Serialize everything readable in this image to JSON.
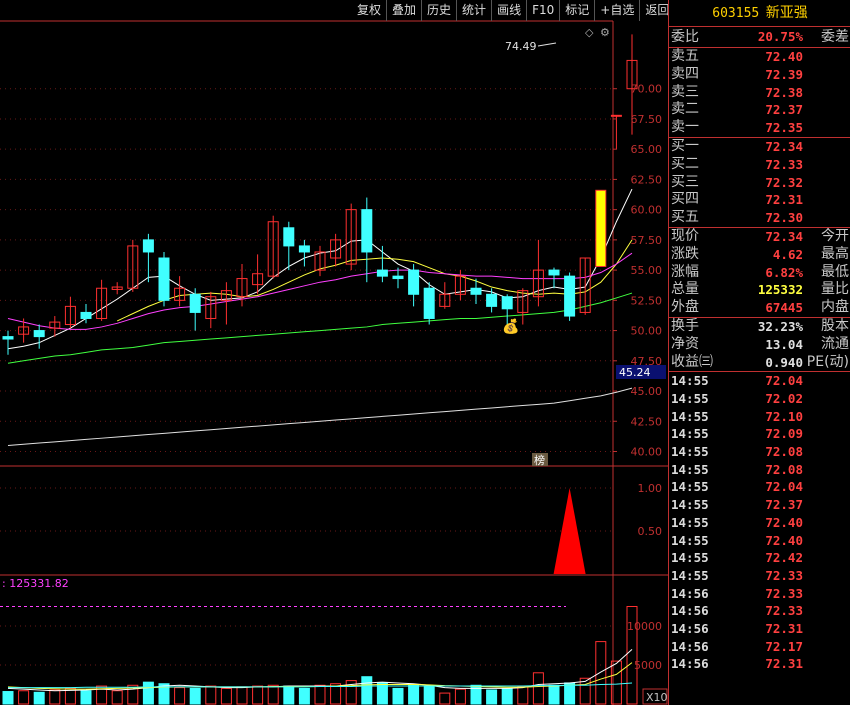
{
  "toolbar": [
    "复权",
    "叠加",
    "历史",
    "统计",
    "画线",
    "F10",
    "标记",
    "+自选",
    "返回"
  ],
  "stock": {
    "code": "603155",
    "name": "新亚强"
  },
  "weibi": {
    "label": "委比",
    "value": "20.75%",
    "label2": "委差"
  },
  "sell": [
    {
      "label": "卖五",
      "price": "72.40"
    },
    {
      "label": "卖四",
      "price": "72.39"
    },
    {
      "label": "卖三",
      "price": "72.38"
    },
    {
      "label": "卖二",
      "price": "72.37"
    },
    {
      "label": "卖一",
      "price": "72.35"
    }
  ],
  "buy": [
    {
      "label": "买一",
      "price": "72.34"
    },
    {
      "label": "买二",
      "price": "72.33"
    },
    {
      "label": "买三",
      "price": "72.32"
    },
    {
      "label": "买四",
      "price": "72.31"
    },
    {
      "label": "买五",
      "price": "72.30"
    }
  ],
  "quote": [
    {
      "label": "现价",
      "value": "72.34",
      "label2": "今开",
      "color": "red"
    },
    {
      "label": "涨跌",
      "value": "4.62",
      "label2": "最高",
      "color": "red"
    },
    {
      "label": "涨幅",
      "value": "6.82%",
      "label2": "最低",
      "color": "red"
    },
    {
      "label": "总量",
      "value": "125332",
      "label2": "量比",
      "color": "yellow"
    },
    {
      "label": "外盘",
      "value": "67445",
      "label2": "内盘",
      "color": "red"
    }
  ],
  "extra": [
    {
      "label": "换手",
      "value": "32.23%",
      "label2": "股本"
    },
    {
      "label": "净资",
      "value": "13.04",
      "label2": "流通"
    },
    {
      "label": "收益㈢",
      "value": "0.940",
      "label2": "PE(动)"
    }
  ],
  "ticks": [
    {
      "time": "14:55",
      "price": "72.04"
    },
    {
      "time": "14:55",
      "price": "72.02"
    },
    {
      "time": "14:55",
      "price": "72.10"
    },
    {
      "time": "14:55",
      "price": "72.09"
    },
    {
      "time": "14:55",
      "price": "72.08"
    },
    {
      "time": "14:55",
      "price": "72.08"
    },
    {
      "time": "14:55",
      "price": "72.04"
    },
    {
      "time": "14:55",
      "price": "72.37"
    },
    {
      "time": "14:55",
      "price": "72.40"
    },
    {
      "time": "14:55",
      "price": "72.40"
    },
    {
      "time": "14:55",
      "price": "72.42"
    },
    {
      "time": "14:55",
      "price": "72.33"
    },
    {
      "time": "14:56",
      "price": "72.33"
    },
    {
      "time": "14:56",
      "price": "72.33"
    },
    {
      "time": "14:56",
      "price": "72.31"
    },
    {
      "time": "14:56",
      "price": "72.17"
    },
    {
      "time": "14:56",
      "price": "72.31"
    }
  ],
  "chart_data": {
    "type": "candlestick",
    "price_axis": {
      "ticks": [
        "40.00",
        "42.50",
        "45.00",
        "47.50",
        "50.00",
        "52.50",
        "55.00",
        "57.50",
        "60.00",
        "62.50",
        "65.00",
        "67.50",
        "70.00"
      ],
      "ylim": [
        38.8,
        75.6
      ]
    },
    "high_label": "74.49",
    "current_marker": "45.24",
    "bang_label": "榜",
    "indicator_axis": {
      "ticks": [
        "1.00",
        "0.50"
      ]
    },
    "volume_axis": {
      "ticks": [
        "10000",
        "5000"
      ],
      "multiplier": "X10"
    },
    "volume_header": ": 125331.82",
    "candles": [
      {
        "o": 49.5,
        "c": 49.3,
        "h": 50.0,
        "l": 48.0
      },
      {
        "o": 49.7,
        "c": 50.3,
        "h": 51.0,
        "l": 49.0
      },
      {
        "o": 50.0,
        "c": 49.5,
        "h": 50.5,
        "l": 48.5
      },
      {
        "o": 50.2,
        "c": 50.7,
        "h": 51.2,
        "l": 49.5
      },
      {
        "o": 50.5,
        "c": 52.0,
        "h": 52.8,
        "l": 50.2
      },
      {
        "o": 51.5,
        "c": 51.0,
        "h": 52.2,
        "l": 50.6
      },
      {
        "o": 51.0,
        "c": 53.5,
        "h": 54.2,
        "l": 50.8
      },
      {
        "o": 53.4,
        "c": 53.6,
        "h": 54.0,
        "l": 53.0
      },
      {
        "o": 53.5,
        "c": 57.0,
        "h": 57.5,
        "l": 53.2
      },
      {
        "o": 57.5,
        "c": 56.5,
        "h": 58.0,
        "l": 54.0
      },
      {
        "o": 56.0,
        "c": 52.5,
        "h": 56.5,
        "l": 52.0
      },
      {
        "o": 52.5,
        "c": 53.5,
        "h": 54.5,
        "l": 52.0
      },
      {
        "o": 53.0,
        "c": 51.5,
        "h": 53.5,
        "l": 50.0
      },
      {
        "o": 51.0,
        "c": 52.8,
        "h": 53.2,
        "l": 50.2
      },
      {
        "o": 52.5,
        "c": 53.3,
        "h": 54.0,
        "l": 50.5
      },
      {
        "o": 52.8,
        "c": 54.3,
        "h": 55.5,
        "l": 52.0
      },
      {
        "o": 53.8,
        "c": 54.7,
        "h": 56.3,
        "l": 53.0
      },
      {
        "o": 54.5,
        "c": 59.0,
        "h": 59.5,
        "l": 54.3
      },
      {
        "o": 58.5,
        "c": 57.0,
        "h": 59.0,
        "l": 55.0
      },
      {
        "o": 57.0,
        "c": 56.5,
        "h": 57.5,
        "l": 55.3
      },
      {
        "o": 55.0,
        "c": 56.5,
        "h": 57.0,
        "l": 54.5
      },
      {
        "o": 56.0,
        "c": 57.5,
        "h": 58.0,
        "l": 55.3
      },
      {
        "o": 55.5,
        "c": 60.0,
        "h": 60.5,
        "l": 55.0
      },
      {
        "o": 60.0,
        "c": 56.5,
        "h": 61.0,
        "l": 54.0
      },
      {
        "o": 55.0,
        "c": 54.5,
        "h": 57.0,
        "l": 54.0
      },
      {
        "o": 54.5,
        "c": 54.3,
        "h": 55.2,
        "l": 53.5
      },
      {
        "o": 55.0,
        "c": 53.0,
        "h": 55.5,
        "l": 52.0
      },
      {
        "o": 53.5,
        "c": 51.0,
        "h": 54.0,
        "l": 50.5
      },
      {
        "o": 52.0,
        "c": 53.0,
        "h": 54.0,
        "l": 51.8
      },
      {
        "o": 53.0,
        "c": 54.5,
        "h": 55.0,
        "l": 52.5
      },
      {
        "o": 53.5,
        "c": 53.0,
        "h": 54.3,
        "l": 52.2
      },
      {
        "o": 53.0,
        "c": 52.0,
        "h": 53.5,
        "l": 51.5
      },
      {
        "o": 52.8,
        "c": 51.8,
        "h": 53.0,
        "l": 50.0
      },
      {
        "o": 51.5,
        "c": 53.3,
        "h": 53.5,
        "l": 50.5
      },
      {
        "o": 52.8,
        "c": 55.0,
        "h": 57.5,
        "l": 52.0
      },
      {
        "o": 55.0,
        "c": 54.6,
        "h": 55.2,
        "l": 53.5
      },
      {
        "o": 54.5,
        "c": 51.2,
        "h": 54.8,
        "l": 50.8
      },
      {
        "o": 51.5,
        "c": 56.0,
        "h": 56.0,
        "l": 51.3
      },
      {
        "o": 55.3,
        "c": 61.6,
        "h": 61.6,
        "l": 55.3
      },
      {
        "o": 67.8,
        "c": 67.8,
        "h": 67.8,
        "l": 65.0
      },
      {
        "o": 70.0,
        "c": 72.34,
        "h": 74.49,
        "l": 66.2
      }
    ],
    "ma_series": [
      {
        "color": "#ffffff",
        "values": [
          48.5,
          48.7,
          49.0,
          49.6,
          50.2,
          51.0,
          51.8,
          52.6,
          53.5,
          54.4,
          54.5,
          53.7,
          53.0,
          52.5,
          52.6,
          52.7,
          53.2,
          54.4,
          55.3,
          56.0,
          56.4,
          56.6,
          57.4,
          57.5,
          56.5,
          55.5,
          54.9,
          53.8,
          53.0,
          53.2,
          53.4,
          53.2,
          52.7,
          52.8,
          53.3,
          53.6,
          53.4,
          53.6,
          56.0,
          59.0,
          61.7
        ]
      },
      {
        "color": "#ffff40",
        "values": [
          null,
          null,
          null,
          null,
          null,
          null,
          null,
          50.8,
          51.4,
          52.0,
          52.5,
          52.9,
          53.0,
          53.1,
          53.0,
          52.8,
          52.9,
          53.4,
          54.0,
          54.6,
          55.1,
          55.4,
          55.8,
          55.9,
          56.0,
          55.9,
          55.7,
          55.2,
          54.7,
          54.5,
          54.1,
          53.6,
          53.3,
          53.1,
          53.0,
          53.1,
          53.0,
          53.2,
          54.0,
          55.5,
          57.5
        ]
      },
      {
        "color": "#ff40ff",
        "values": [
          51.0,
          50.7,
          50.4,
          50.2,
          50.1,
          50.1,
          50.3,
          50.6,
          51.0,
          51.4,
          51.7,
          51.9,
          52.0,
          52.2,
          52.4,
          52.6,
          52.8,
          53.1,
          53.4,
          53.7,
          54.0,
          54.2,
          54.5,
          54.7,
          54.9,
          55.0,
          55.0,
          54.8,
          54.7,
          54.6,
          54.5,
          54.5,
          54.4,
          54.3,
          54.3,
          54.3,
          54.3,
          54.4,
          54.8,
          55.5,
          56.4
        ]
      },
      {
        "color": "#40ff40",
        "values": [
          47.3,
          47.5,
          47.7,
          47.9,
          48.0,
          48.2,
          48.4,
          48.5,
          48.6,
          48.8,
          49.0,
          49.1,
          49.2,
          49.3,
          49.4,
          49.5,
          49.6,
          49.7,
          49.8,
          49.9,
          50.0,
          50.1,
          50.2,
          50.3,
          50.5,
          50.6,
          50.7,
          50.8,
          50.9,
          51.0,
          51.0,
          51.1,
          51.2,
          51.3,
          51.4,
          51.5,
          51.7,
          52.0,
          52.3,
          52.7,
          53.1
        ]
      },
      {
        "color": "#e0e0e0",
        "values": [
          40.5,
          40.6,
          40.7,
          40.8,
          40.9,
          41.0,
          41.1,
          41.2,
          41.3,
          41.4,
          41.5,
          41.6,
          41.7,
          41.8,
          41.9,
          42.0,
          42.1,
          42.2,
          42.3,
          42.4,
          42.5,
          42.6,
          42.7,
          42.8,
          42.9,
          43.0,
          43.1,
          43.2,
          43.3,
          43.4,
          43.5,
          43.6,
          43.7,
          43.8,
          43.9,
          44.0,
          44.2,
          44.4,
          44.6,
          44.9,
          45.24
        ]
      }
    ],
    "volumes": [
      1600,
      1700,
      1500,
      1800,
      2000,
      1700,
      2300,
      1700,
      2400,
      2800,
      2600,
      2100,
      2000,
      2300,
      2000,
      2200,
      2300,
      2400,
      2300,
      2000,
      2400,
      2600,
      3000,
      3500,
      2700,
      2000,
      2400,
      2200,
      1400,
      1900,
      2400,
      1800,
      2000,
      2200,
      4000,
      2400,
      2700,
      3300,
      8000,
      5500,
      12500
    ],
    "volume_ma": [
      {
        "color": "#ffffff",
        "values": [
          2000,
          1900,
          1800,
          1700,
          1750,
          1800,
          1900,
          1800,
          1900,
          2100,
          2300,
          2400,
          2300,
          2200,
          2100,
          2100,
          2200,
          2200,
          2300,
          2300,
          2300,
          2300,
          2500,
          2700,
          2800,
          2700,
          2600,
          2400,
          2100,
          2000,
          2000,
          2000,
          2000,
          2100,
          2500,
          2600,
          2700,
          2900,
          4100,
          5200,
          7000
        ]
      },
      {
        "color": "#ffff40",
        "values": [
          2200,
          2100,
          2000,
          1950,
          1900,
          1900,
          1950,
          2000,
          2050,
          2100,
          2150,
          2200,
          2200,
          2200,
          2200,
          2200,
          2200,
          2250,
          2250,
          2250,
          2250,
          2300,
          2350,
          2450,
          2500,
          2500,
          2500,
          2450,
          2350,
          2300,
          2250,
          2200,
          2150,
          2150,
          2250,
          2300,
          2400,
          2500,
          3200,
          3800,
          5300
        ]
      },
      {
        "color": "#40ffff",
        "values": [
          2100,
          2100,
          2100,
          2100,
          2100,
          2150,
          2150,
          2150,
          2150,
          2200,
          2200,
          2200,
          2200,
          2200,
          2200,
          2200,
          2200,
          2200,
          2200,
          2200,
          2250,
          2250,
          2250,
          2300,
          2300,
          2300,
          2300,
          2300,
          2300,
          2300,
          2300,
          2300,
          2300,
          2300,
          2350,
          2350,
          2400,
          2400,
          2500,
          2550,
          2700
        ]
      }
    ],
    "indicator_spike": {
      "index": 36,
      "value": 1.0
    }
  }
}
